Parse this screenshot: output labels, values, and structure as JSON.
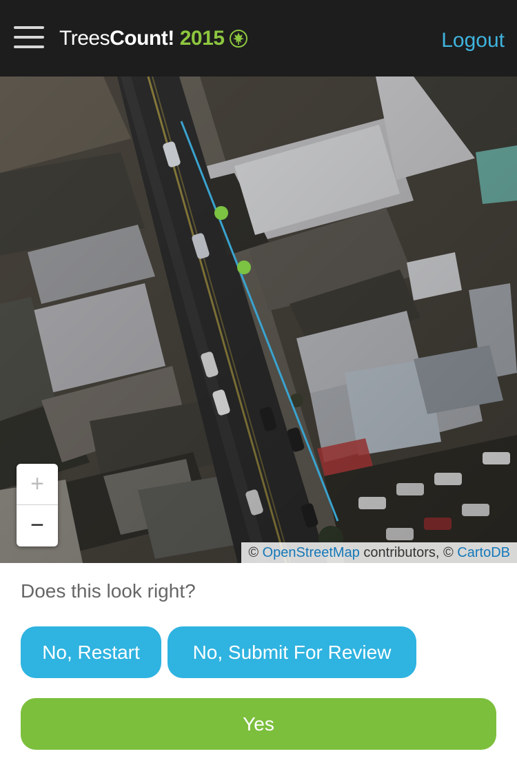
{
  "header": {
    "logo": {
      "part1": "Trees",
      "part2": "Count!",
      "year": "2015",
      "icon": "leaf-icon"
    },
    "menu_icon": "hamburger-menu-icon",
    "logout_label": "Logout"
  },
  "map": {
    "zoom_in_label": "+",
    "zoom_out_label": "−",
    "attribution": {
      "prefix": "© ",
      "osm_link": "OpenStreetMap",
      "middle": " contributors, © ",
      "carto_link": "CartoDB"
    },
    "colors": {
      "block_line": "#3aa3cf",
      "tree_point": "#7cc243"
    }
  },
  "prompt": {
    "question": "Does this look right?",
    "restart_label": "No, Restart",
    "review_label": "No, Submit For Review",
    "yes_label": "Yes"
  },
  "colors": {
    "header_bg": "#1d1d1d",
    "brand_green": "#8dc63f",
    "accent_blue": "#2fb3e0",
    "confirm_green": "#7cbf3d"
  }
}
